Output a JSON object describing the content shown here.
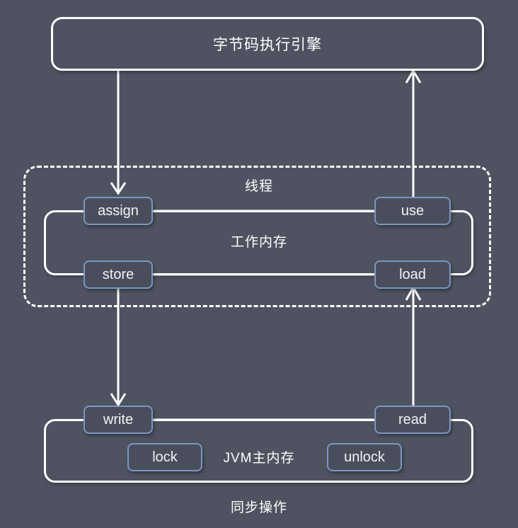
{
  "diagram": {
    "title_text": "字节码执行引擎",
    "background_color": "#4f5361",
    "line_color": "#ffffff",
    "node_border_color": "#7b97c4",
    "node_fill_color": "#4a4e5c",
    "engine": {
      "label": "字节码执行引擎"
    },
    "thread": {
      "label": "线程",
      "border_style": "dashed"
    },
    "working_memory": {
      "label": "工作内存",
      "border_style": "solid"
    },
    "main_memory": {
      "label": "JVM主内存",
      "border_style": "solid"
    },
    "sync": {
      "label": "同步操作"
    },
    "nodes": [
      {
        "id": "assign",
        "label": "assign"
      },
      {
        "id": "use",
        "label": "use"
      },
      {
        "id": "store",
        "label": "store"
      },
      {
        "id": "load",
        "label": "load"
      },
      {
        "id": "write",
        "label": "write"
      },
      {
        "id": "read",
        "label": "read"
      },
      {
        "id": "lock",
        "label": "lock"
      },
      {
        "id": "unlock",
        "label": "unlock"
      }
    ],
    "connections": [
      {
        "from": "字节码执行引擎",
        "to": "assign",
        "arrow": "down"
      },
      {
        "from": "use",
        "to": "字节码执行引擎",
        "arrow": "up"
      },
      {
        "from": "store",
        "to": "write",
        "arrow": "down"
      },
      {
        "from": "read",
        "to": "load",
        "arrow": "up"
      },
      {
        "from": "assign",
        "to": "use",
        "arrow": "none"
      },
      {
        "from": "store",
        "to": "load",
        "arrow": "none"
      },
      {
        "from": "write",
        "to": "read",
        "arrow": "none"
      }
    ]
  }
}
